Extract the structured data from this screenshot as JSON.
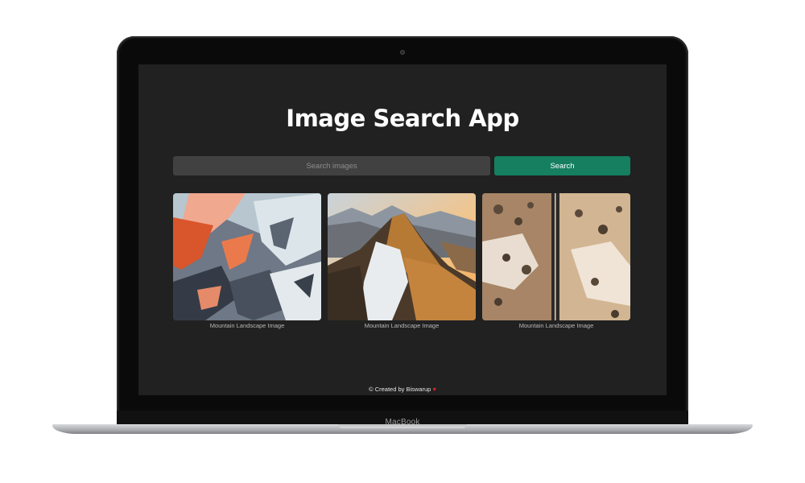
{
  "device": {
    "brand_label": "MacBook"
  },
  "app": {
    "title": "Image Search App",
    "search": {
      "placeholder": "Search images",
      "value": "",
      "button_label": "Search"
    },
    "results": [
      {
        "caption": "Mountain Landscape Image"
      },
      {
        "caption": "Mountain Landscape Image"
      },
      {
        "caption": "Mountain Landscape Image"
      }
    ],
    "footer": {
      "text": "© Created by Biswarup",
      "heart": "♥"
    }
  },
  "colors": {
    "page_background": "#212121",
    "input_background": "#414141",
    "accent": "#167f60",
    "heart": "#e02424"
  }
}
